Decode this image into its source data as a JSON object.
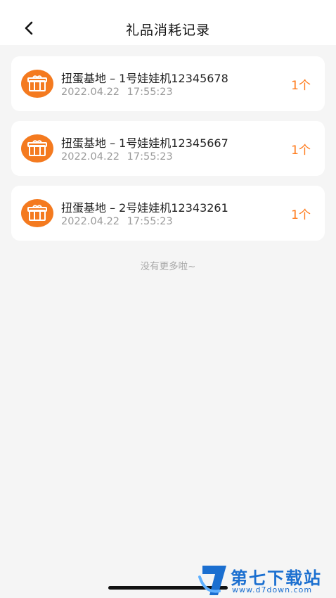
{
  "header": {
    "title": "礼品消耗记录"
  },
  "records": [
    {
      "name": "扭蛋基地 – 1号娃娃机12345678",
      "time": "2022.04.22 17:55:23",
      "quantity": "1个"
    },
    {
      "name": "扭蛋基地 – 1号娃娃机12345667",
      "time": "2022.04.22 17:55:23",
      "quantity": "1个"
    },
    {
      "name": "扭蛋基地 – 2号娃娃机12343261",
      "time": "2022.04.22 17:55:23",
      "quantity": "1个"
    }
  ],
  "footer": {
    "no_more": "没有更多啦~"
  },
  "watermark": {
    "brand": "第七下载站",
    "url": "www.d7down.com"
  },
  "colors": {
    "accent": "#ff7a1a",
    "background": "#f5f5f5",
    "watermark": "#1b6fd0"
  },
  "icons": {
    "back": "chevron-left-icon",
    "gift": "gift-icon"
  }
}
